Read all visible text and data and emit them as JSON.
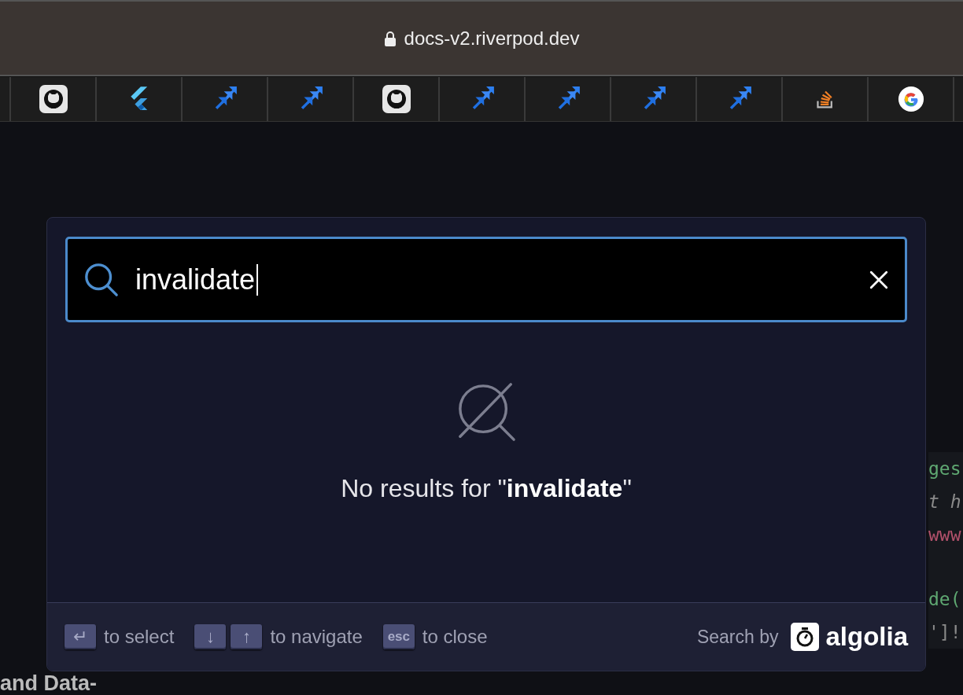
{
  "browser": {
    "address": "docs-v2.riverpod.dev",
    "secure": true
  },
  "bookmarks": [
    {
      "kind": "github"
    },
    {
      "kind": "flutter"
    },
    {
      "kind": "jira"
    },
    {
      "kind": "jira"
    },
    {
      "kind": "github"
    },
    {
      "kind": "jira"
    },
    {
      "kind": "jira"
    },
    {
      "kind": "jira"
    },
    {
      "kind": "jira"
    },
    {
      "kind": "stackoverflow"
    },
    {
      "kind": "google"
    }
  ],
  "page": {
    "heading": "and Data-",
    "code_blocks": [
      [
        {
          "text": "ges",
          "kind": "string"
        },
        {
          "text": "t h",
          "kind": "comment"
        },
        {
          "text": "www",
          "kind": "url"
        }
      ],
      [
        {
          "text": "de(",
          "kind": "string"
        },
        {
          "text": "']!",
          "kind": "plain"
        }
      ]
    ]
  },
  "search_modal": {
    "query": "invalidate",
    "no_results": "No results for \"**invalidate**\"",
    "hints": [
      {
        "keys": [
          "↵"
        ],
        "label": "to select"
      },
      {
        "keys": [
          "↓",
          "↑"
        ],
        "label": "to navigate"
      },
      {
        "keys": [
          "esc"
        ],
        "label": "to close"
      }
    ],
    "search_by": "Search by",
    "brand": "algolia"
  }
}
